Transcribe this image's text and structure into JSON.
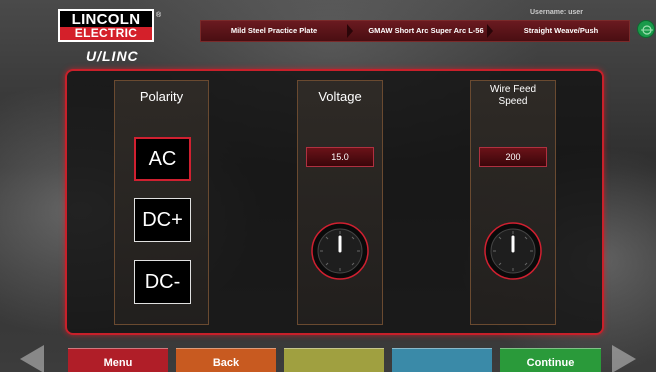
{
  "header": {
    "logo_top": "LINCOLN",
    "logo_bottom": "ELECTRIC",
    "logo_reg": "®",
    "product": "U/LINC",
    "username": "Username: user",
    "breadcrumbs": [
      {
        "label": "Mild Steel Practice Plate"
      },
      {
        "label": "GMAW Short Arc Super Arc L-56"
      },
      {
        "label": "Straight Weave/Push"
      }
    ]
  },
  "polarity": {
    "title": "Polarity",
    "options": [
      "AC",
      "DC+",
      "DC-"
    ],
    "selected": "AC"
  },
  "voltage": {
    "title": "Voltage",
    "value": "15.0"
  },
  "wire_feed": {
    "title_line1": "Wire Feed",
    "title_line2": "Speed",
    "value": "200"
  },
  "footer": {
    "menu_label": "Menu",
    "back_label": "Back",
    "blank1_label": "",
    "blank2_label": "",
    "continue_label": "Continue"
  },
  "colors": {
    "accent_red": "#c8202a",
    "menu": "#b01e28",
    "back": "#c85a20",
    "blank1": "#a0a040",
    "blank2": "#3a8aa8",
    "continue": "#2a9a3a"
  },
  "icons": {
    "corner": "status-icon",
    "left_arrow": "left-arrow-icon",
    "right_arrow": "right-arrow-icon",
    "knob": "knob-icon"
  }
}
